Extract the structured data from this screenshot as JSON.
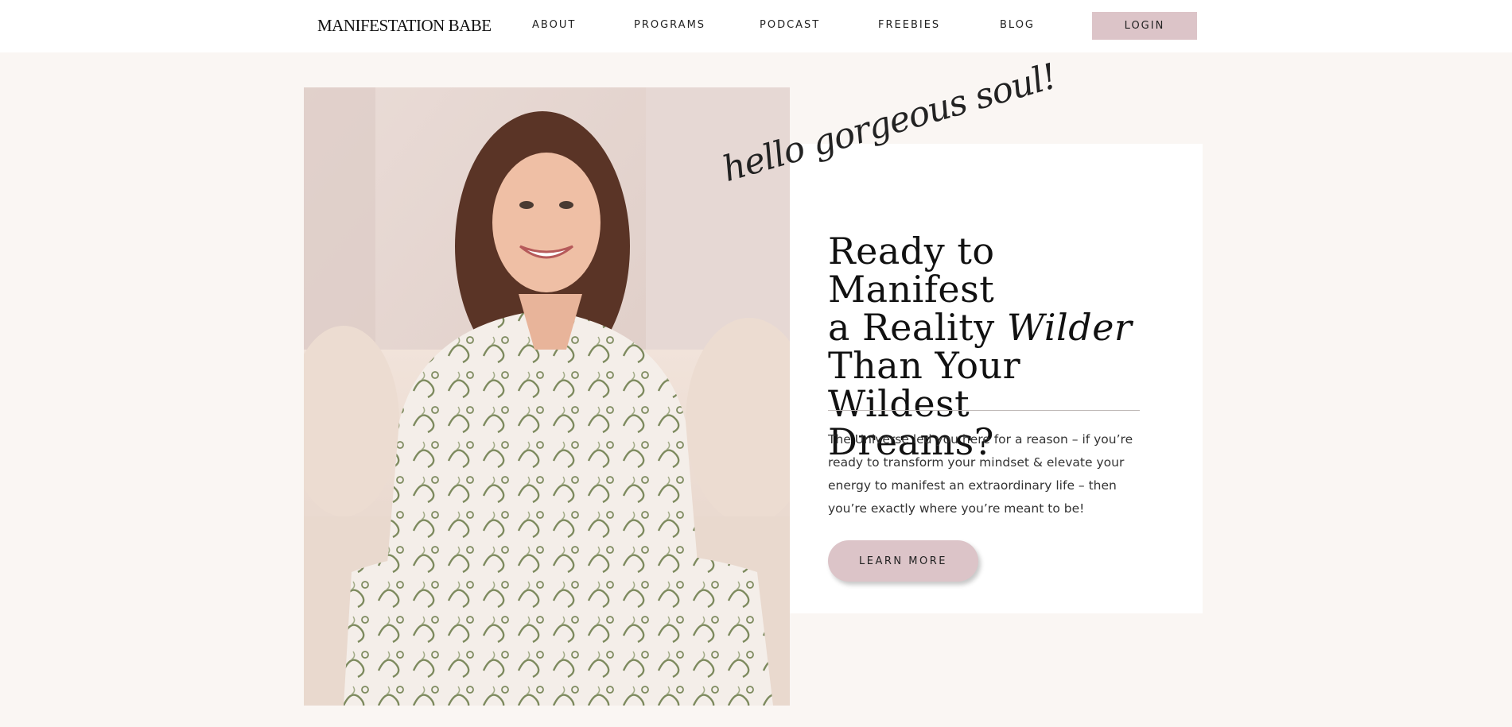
{
  "header": {
    "logo": "MANIFESTATION BABE",
    "nav": [
      "ABOUT",
      "PROGRAMS",
      "PODCAST",
      "FREEBIES",
      "BLOG"
    ],
    "login_label": "LOGIN"
  },
  "hero": {
    "script_greeting": "hello gorgeous soul!",
    "headline": {
      "line1": "Ready to Manifest",
      "line2_start": "a Reality ",
      "line2_emphasis": "Wilder",
      "line3": "Than Your Wildest",
      "line4": "Dreams?"
    },
    "body": "The Universe led you here for a reason – if you’re ready to transform your mindset & elevate your energy to manifest an extraordinary life – then you’re exactly where you’re meant to be!",
    "cta_label": "LEARN MORE"
  },
  "colors": {
    "page_bg": "#faf6f3",
    "accent_pink": "#dcc4c8",
    "card_bg": "#ffffff"
  }
}
